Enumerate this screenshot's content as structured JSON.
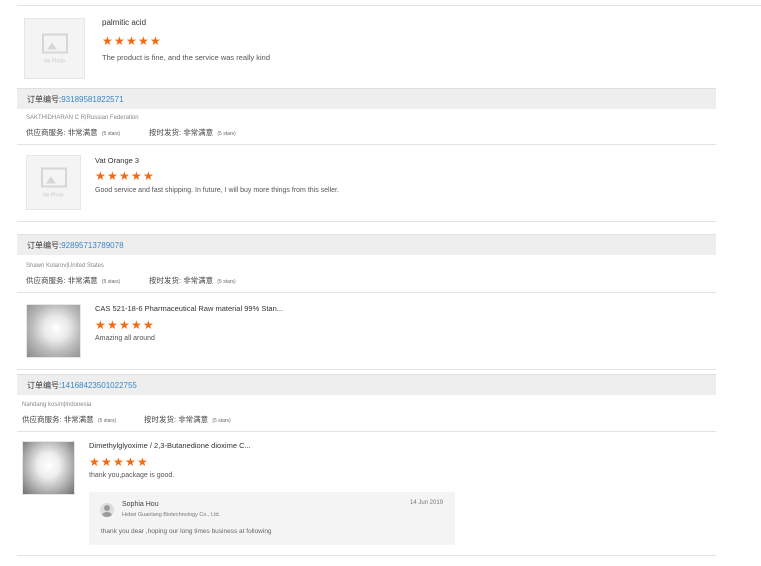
{
  "reviews": [
    {
      "product": "palmitic acid",
      "stars": 5,
      "comment": "The product is fine, and the service was really kind",
      "photo": "No Photo"
    },
    {
      "order_label": "订单编号:",
      "order_number": "93189581822571",
      "buyer": "SAKTHIDHARAN C R|Russian Federation",
      "supplier_service_label": "供应商服务:",
      "supplier_service_value": "非常满意",
      "supplier_service_stars": "(5 stars)",
      "on_time_label": "按时发货:",
      "on_time_value": "非常满意",
      "on_time_stars": "(5 stars)",
      "product": "Vat Orange 3",
      "stars": 5,
      "comment": "Good service and fast shipping. In future, I will buy more things from this seller.",
      "photo": "No Photo"
    },
    {
      "order_label": "订单编号:",
      "order_number": "92895713789078",
      "buyer": "Shawn Kolarov|United States",
      "supplier_service_label": "供应商服务:",
      "supplier_service_value": "非常满意",
      "supplier_service_stars": "(5 stars)",
      "on_time_label": "按时发货:",
      "on_time_value": "非常满意",
      "on_time_stars": "(5 stars)",
      "product": "CAS 521-18-6 Pharmaceutical Raw material 99% Stan...",
      "stars": 5,
      "comment": "Amazing all around"
    },
    {
      "order_label": "订单编号:",
      "order_number": "141684235010227​55",
      "buyer": "Nandang kosim|Indonesia",
      "supplier_service_label": "供应商服务:",
      "supplier_service_value": "非常满意",
      "supplier_service_stars": "(5 stars)",
      "on_time_label": "按时发货:",
      "on_time_value": "非常满意",
      "on_time_stars": "(5 stars)",
      "product": "Dimethylglyoxime / 2,3-Butanedione dioxime C...",
      "stars": 5,
      "comment": "thank you,package is good.",
      "reply": {
        "name": "Sophia Hou",
        "company": "Hebei Guanlang Biotechnology Co., Ltd.",
        "date": "14 Jun 2019",
        "text": "thank you dear ,hoping our long times business at following"
      }
    }
  ],
  "colors": {
    "star": "#f26a10",
    "order_number": "#3a87c8",
    "order_bar": "#eeeeee"
  }
}
